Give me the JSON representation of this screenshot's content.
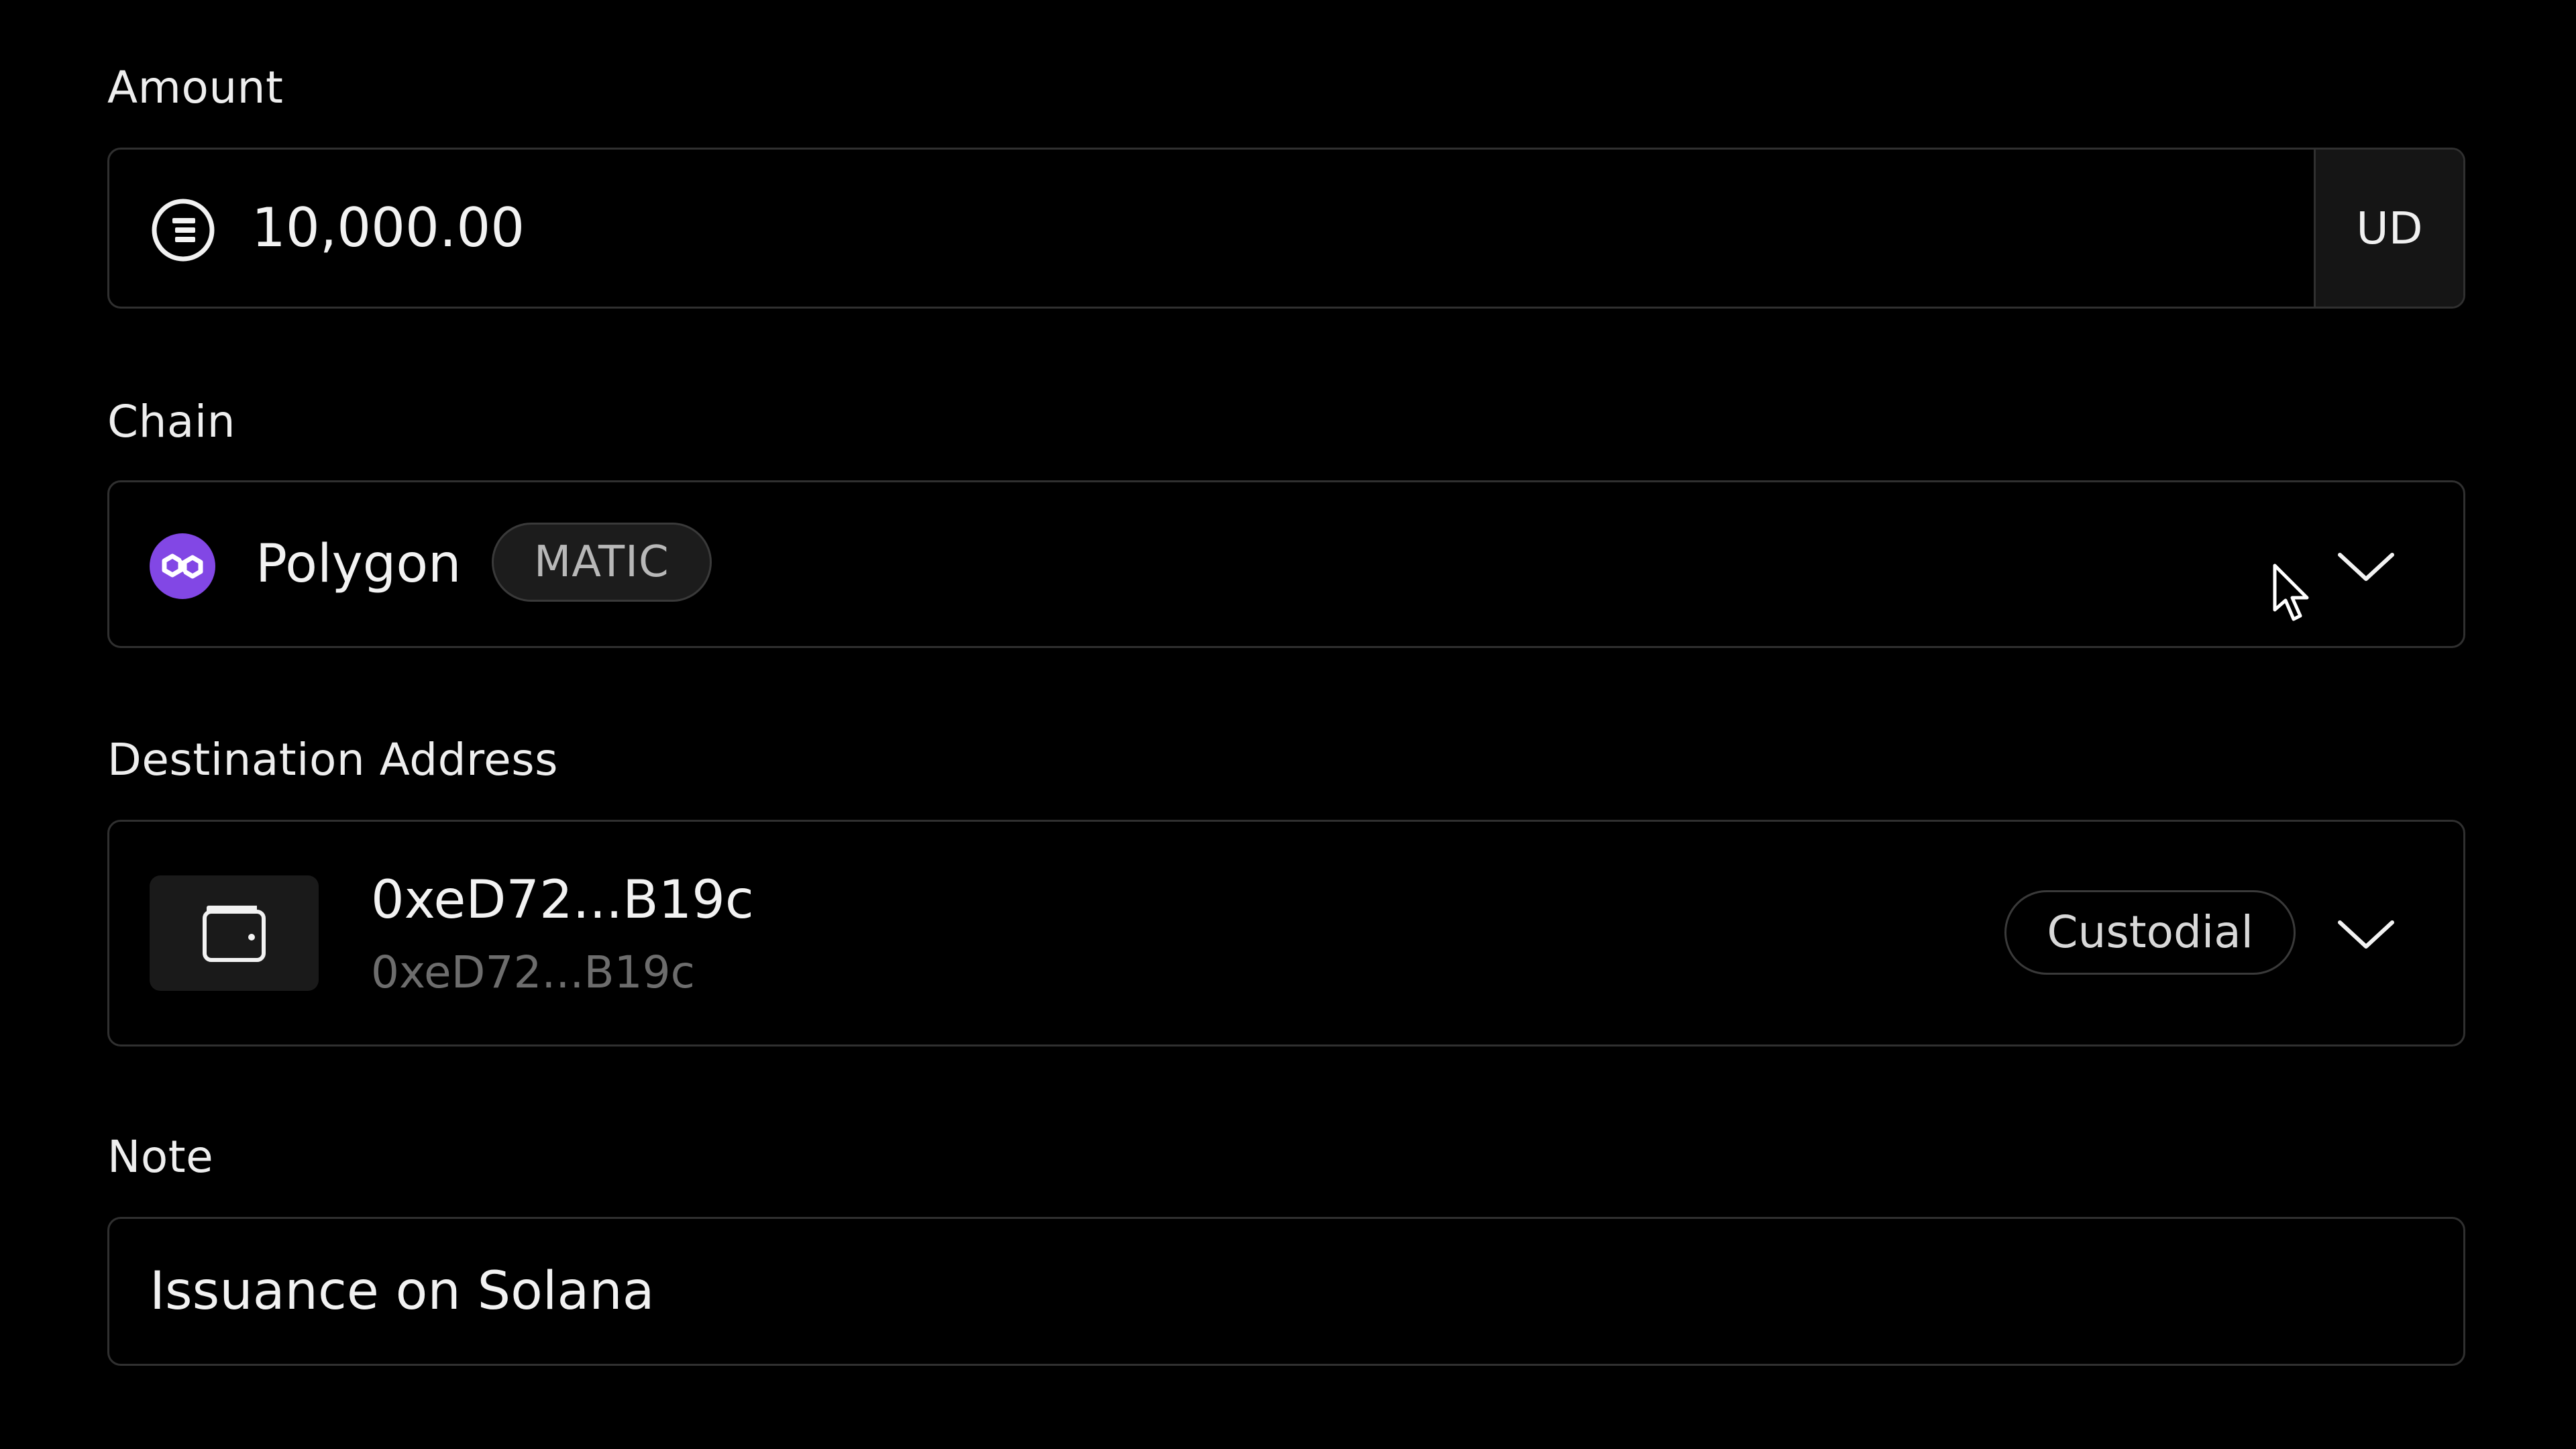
{
  "amount": {
    "label": "Amount",
    "value": "10,000.00",
    "unit": "UD",
    "icon": "coin-icon"
  },
  "chain": {
    "label": "Chain",
    "selected": "Polygon",
    "badge": "MATIC",
    "icon": "polygon-icon",
    "brand_color": "#8247e5"
  },
  "destination": {
    "label": "Destination Address",
    "address": "0xeD72...B19c",
    "address_secondary": "0xeD72...B19c",
    "type_badge": "Custodial",
    "icon": "wallet-icon"
  },
  "note": {
    "label": "Note",
    "value": "Issuance on Solana"
  },
  "colors": {
    "background": "#000000",
    "border": "#303030",
    "muted_text": "#6d6d6d"
  }
}
